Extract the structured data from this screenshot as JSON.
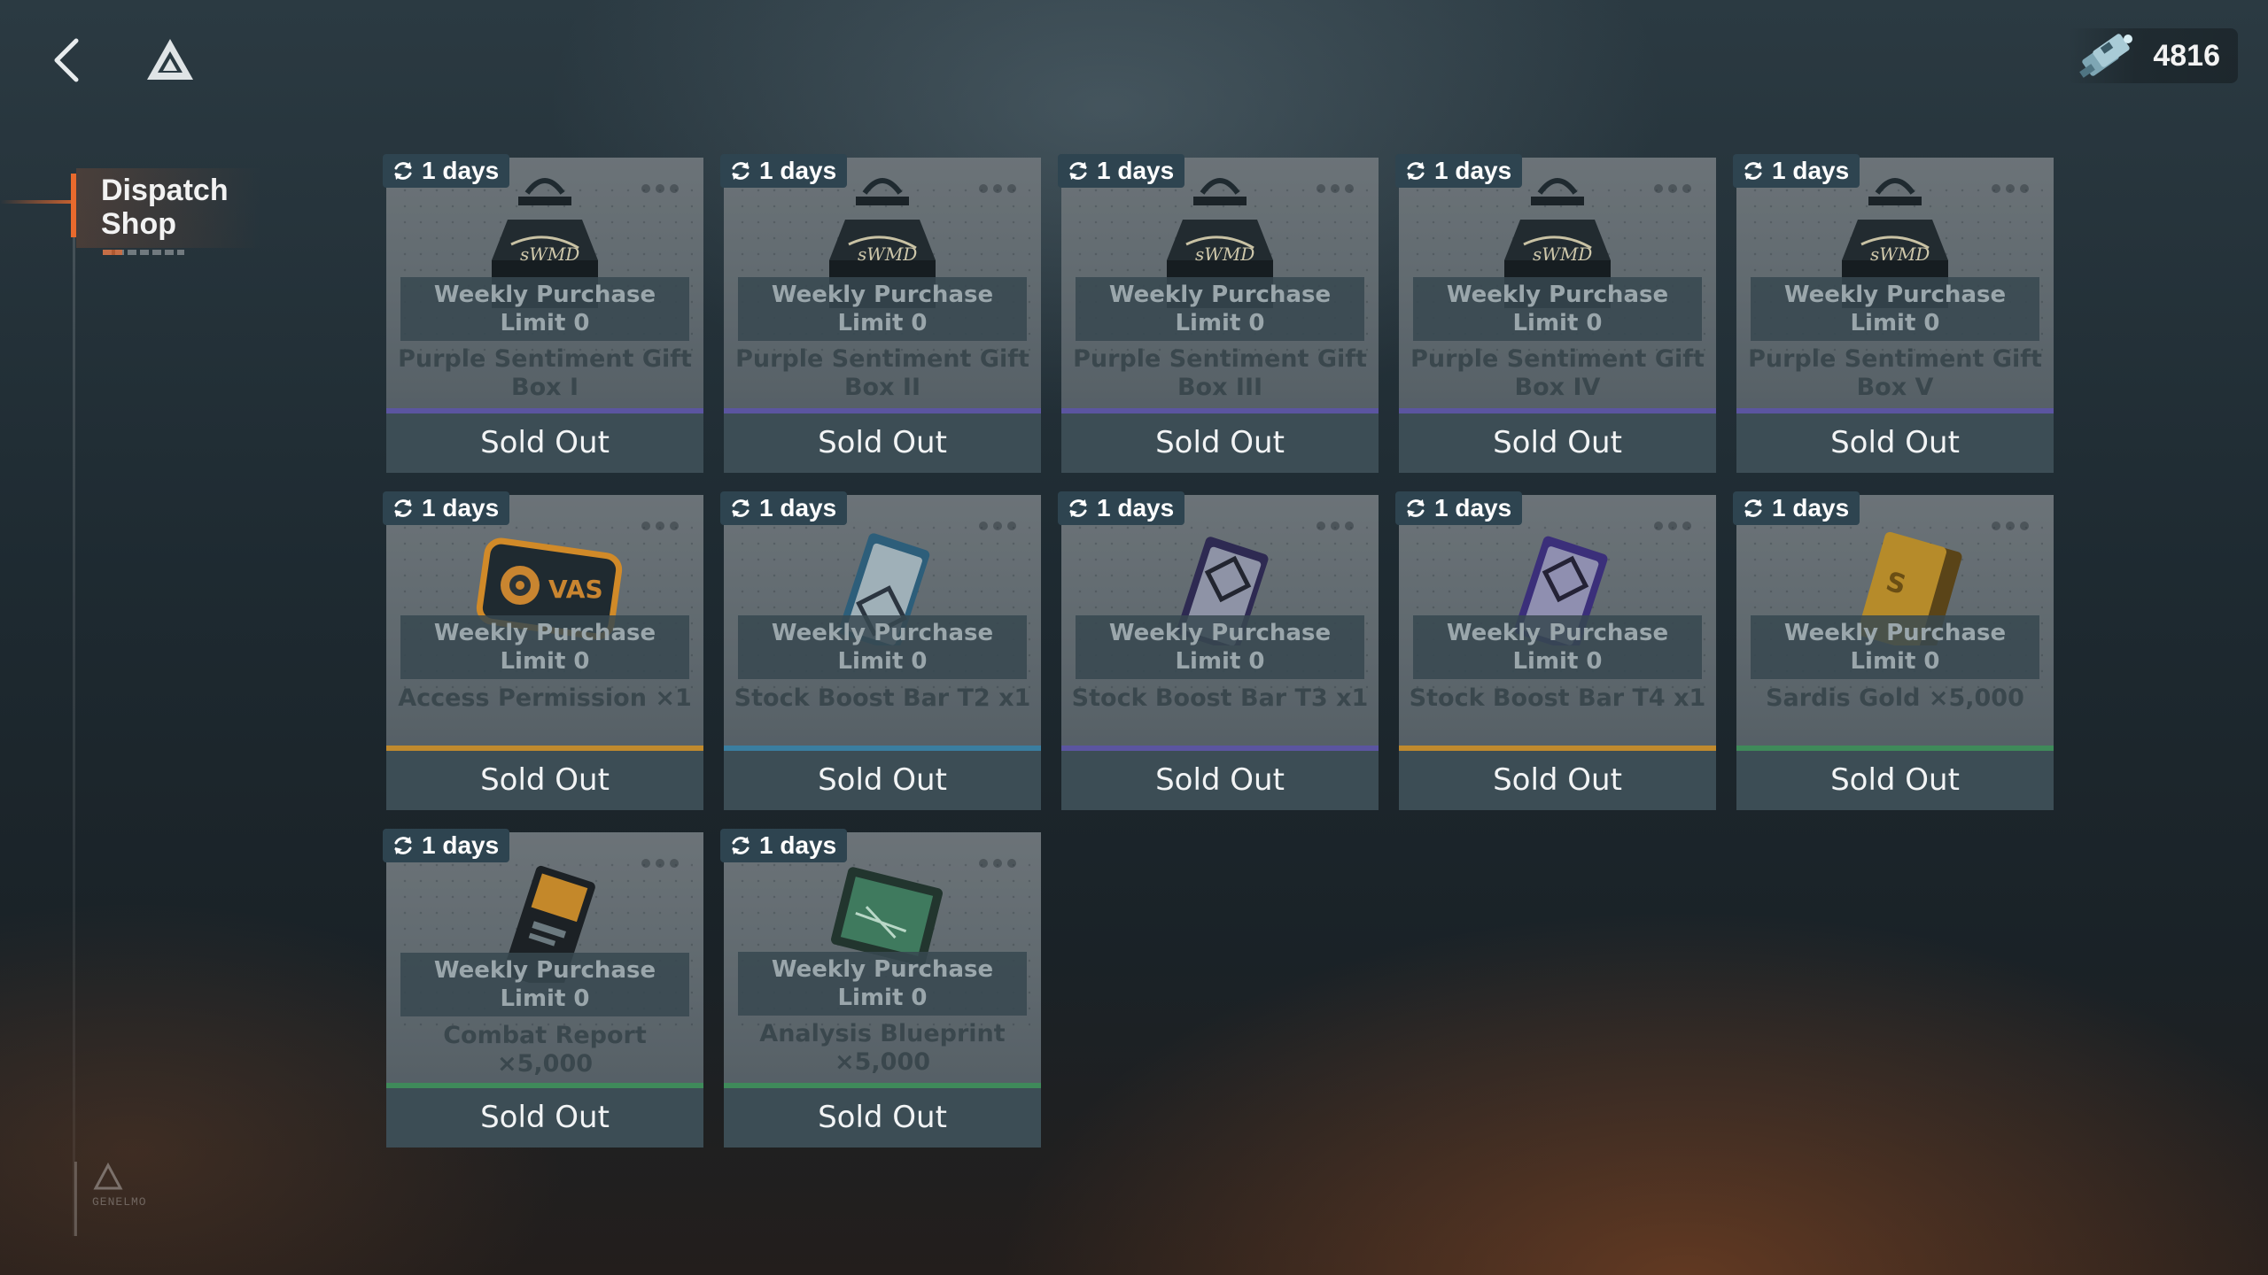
{
  "header": {
    "currency_value": "4816"
  },
  "sidebar": {
    "items": [
      {
        "label": "Dispatch Shop",
        "active": true
      }
    ],
    "emblem_text": "GENELMO"
  },
  "colors": {
    "accent": "#e96a2d",
    "rarity_purple": "#5b55a0",
    "rarity_gold": "#c08a2e",
    "rarity_green": "#3f8a5a",
    "rarity_blue": "#3a7ea0"
  },
  "shop": {
    "items": [
      {
        "timer": "1 days",
        "limit": [
          "Weekly Purchase",
          "Limit 0"
        ],
        "name": "Purple Sentiment Gift Box I",
        "status": "Sold Out",
        "icon": "gift-box-icon",
        "rarity": "purple"
      },
      {
        "timer": "1 days",
        "limit": [
          "Weekly Purchase",
          "Limit 0"
        ],
        "name": "Purple Sentiment Gift Box II",
        "status": "Sold Out",
        "icon": "gift-box-icon",
        "rarity": "purple"
      },
      {
        "timer": "1 days",
        "limit": [
          "Weekly Purchase",
          "Limit 0"
        ],
        "name": "Purple Sentiment Gift Box III",
        "status": "Sold Out",
        "icon": "gift-box-icon",
        "rarity": "purple"
      },
      {
        "timer": "1 days",
        "limit": [
          "Weekly Purchase",
          "Limit 0"
        ],
        "name": "Purple Sentiment Gift Box IV",
        "status": "Sold Out",
        "icon": "gift-box-icon",
        "rarity": "purple"
      },
      {
        "timer": "1 days",
        "limit": [
          "Weekly Purchase",
          "Limit 0"
        ],
        "name": "Purple Sentiment Gift Box V",
        "status": "Sold Out",
        "icon": "gift-box-icon",
        "rarity": "purple"
      },
      {
        "timer": "1 days",
        "limit": [
          "Weekly Purchase",
          "Limit 0"
        ],
        "name": "Access Permission ×1",
        "status": "Sold Out",
        "icon": "access-card-icon",
        "rarity": "gold"
      },
      {
        "timer": "1 days",
        "limit": [
          "Weekly Purchase",
          "Limit 0"
        ],
        "name": "Stock Boost Bar T2 x1",
        "status": "Sold Out",
        "icon": "boost-bar-t2-icon",
        "rarity": "blue"
      },
      {
        "timer": "1 days",
        "limit": [
          "Weekly Purchase",
          "Limit 0"
        ],
        "name": "Stock Boost Bar T3 x1",
        "status": "Sold Out",
        "icon": "boost-bar-t3-icon",
        "rarity": "purple"
      },
      {
        "timer": "1 days",
        "limit": [
          "Weekly Purchase",
          "Limit 0"
        ],
        "name": "Stock Boost Bar T4 x1",
        "status": "Sold Out",
        "icon": "boost-bar-t4-icon",
        "rarity": "gold"
      },
      {
        "timer": "1 days",
        "limit": [
          "Weekly Purchase",
          "Limit 0"
        ],
        "name": "Sardis Gold ×5,000",
        "status": "Sold Out",
        "icon": "gold-bar-icon",
        "rarity": "green"
      },
      {
        "timer": "1 days",
        "limit": [
          "Weekly Purchase",
          "Limit 0"
        ],
        "name": "Combat Report ×5,000",
        "status": "Sold Out",
        "icon": "combat-report-icon",
        "rarity": "green"
      },
      {
        "timer": "1 days",
        "limit": [
          "Weekly Purchase",
          "Limit 0"
        ],
        "name": "Analysis Blueprint ×5,000",
        "status": "Sold Out",
        "icon": "blueprint-icon",
        "rarity": "green"
      }
    ]
  }
}
